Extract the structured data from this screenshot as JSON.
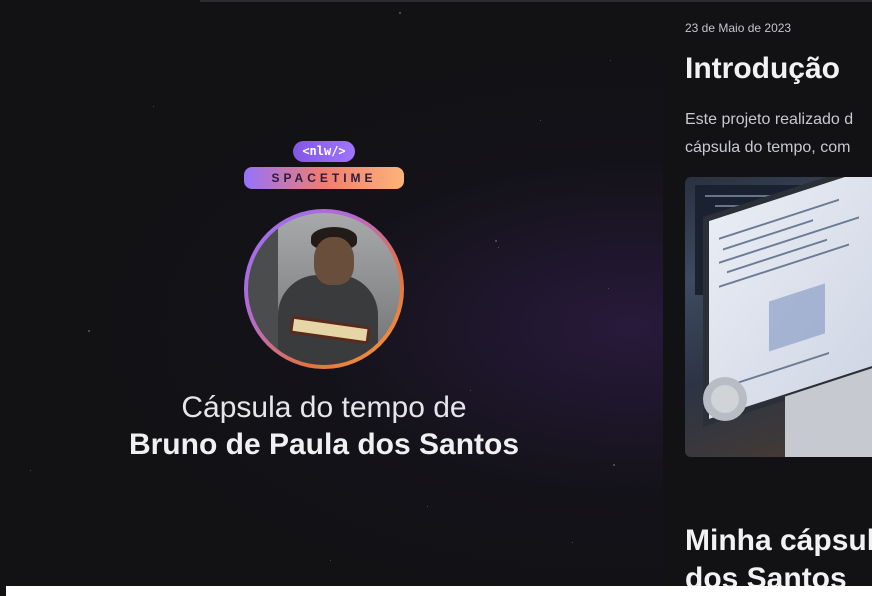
{
  "hero": {
    "logo": {
      "badge_text": "<nlw/>",
      "brand_text": "SPACETIME",
      "colors": {
        "badge": "#8257e5",
        "gradient_start": "#9572fc",
        "gradient_end": "#fdb37a"
      }
    },
    "avatar": {
      "alt": "Bruno de Paula dos Santos"
    },
    "title_prefix": "Cápsula do tempo de",
    "owner_name": "Bruno de Paula dos Santos"
  },
  "memory": {
    "date": "23 de Maio de 2023",
    "title": "Introdução",
    "excerpt_lines": [
      "Este projeto realizado d",
      "cápsula do tempo, com"
    ],
    "image": {
      "icon": "laptop-code-photo"
    },
    "next_title_lines": [
      "Minha cápsul",
      "dos Santos"
    ]
  },
  "colors": {
    "background": "#121215",
    "accent_purple": "#9572fc",
    "accent_orange": "#f3a23c"
  }
}
